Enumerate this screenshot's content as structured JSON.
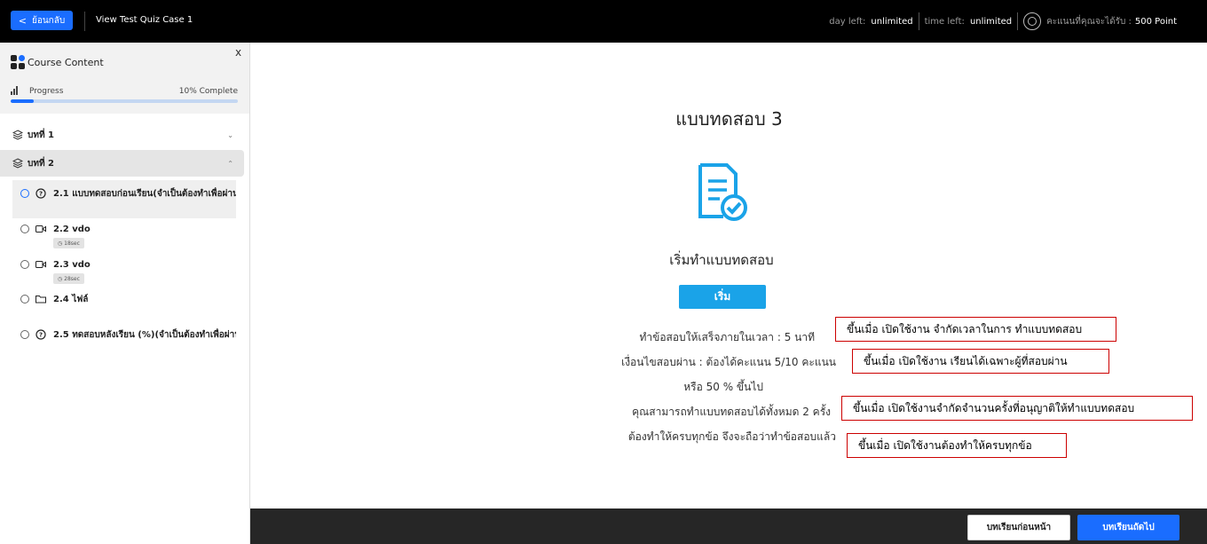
{
  "topbar": {
    "back_label": "ย้อนกลับ",
    "title": "View Test Quiz Case 1",
    "day_left_label": "day left:",
    "day_left_value": "unlimited",
    "time_left_label": "time left:",
    "time_left_value": "unlimited",
    "points_label": "คะแนนที่คุณจะได้รับ :",
    "points_value": "500 Point"
  },
  "sidebar": {
    "title": "Course Content",
    "close_label": "x",
    "progress_label": "Progress",
    "progress_pct_label": "10% Complete",
    "progress_fraction": 0.1,
    "chapters": [
      {
        "label": "บทที่ 1",
        "caret": "⌄"
      },
      {
        "label": "บทที่ 2",
        "caret": "⌃"
      }
    ],
    "lessons": [
      {
        "label": "2.1 แบบทดสอบก่อนเรียน(จำเป็นต้องทำเพื่อผ่านบ",
        "icon": "quiz-icon"
      },
      {
        "label": "2.2 vdo",
        "icon": "video-icon",
        "duration": "18sec"
      },
      {
        "label": "2.3 vdo",
        "icon": "video-icon",
        "duration": "28sec"
      },
      {
        "label": "2.4 ไฟล์",
        "icon": "folder-icon"
      },
      {
        "label": "2.5 ทดสอบหลังเรียน (%)(จำเป็นต้องทำเพื่อผ่านบ",
        "icon": "quiz-icon"
      }
    ]
  },
  "main": {
    "title": "แบบทดสอบ 3",
    "start_heading": "เริ่มทำแบบทดสอบ",
    "start_button": "เริ่ม",
    "rules": [
      "ทำข้อสอบให้เสร็จภายในเวลา : 5 นาที",
      "เงื่อนไขสอบผ่าน : ต้องได้คะแนน 5/10 คะแนน",
      "หรือ 50 % ขึ้นไป",
      "คุณสามารถทำแบบทดสอบได้ทั้งหมด 2 ครั้ง",
      "ต้องทำให้ครบทุกข้อ จึงจะถือว่าทำข้อสอบแล้ว"
    ],
    "notes": [
      "ขึ้นเมื่อ เปิดใช้งาน จำกัดเวลาในการ ทำแบบทดสอบ",
      "ขึ้นเมื่อ เปิดใช้งาน เรียนได้เฉพาะผู้ที่สอบผ่าน",
      "ขึ้นเมื่อ เปิดใช้งานจำกัดจำนวนครั้งที่อนุญาติให้ทำแบบทดสอบ",
      "ขึ้นเมื่อ เปิดใช้งานต้องทำให้ครบทุกข้อ"
    ]
  },
  "footer": {
    "prev_label": "บทเรียนก่อนหน้า",
    "next_label": "บทเรียนถัดไป"
  },
  "colors": {
    "accent": "#1a6dff",
    "start_button": "#1aa3e8",
    "icon_blue": "#1aa3e8",
    "note_border": "#cc0000"
  }
}
